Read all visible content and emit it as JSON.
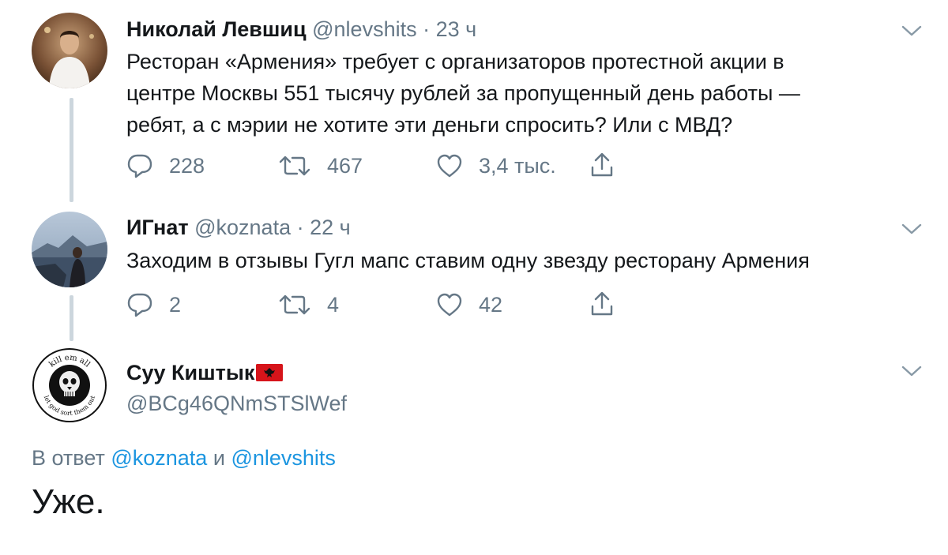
{
  "tweets": [
    {
      "name": "Николай Левшиц",
      "handle": "@nlevshits",
      "time": "23 ч",
      "text_lines": [
        "Ресторан «Армения» требует с организаторов протестной акции в",
        "центре Москвы 551 тысячу рублей за пропущенный день работы —",
        "ребят, а с мэрии не хотите эти деньги спросить? Или с МВД?"
      ],
      "replies": "228",
      "retweets": "467",
      "likes": "3,4 тыс."
    },
    {
      "name": "ИГнат",
      "handle": "@koznata",
      "time": "22 ч",
      "text_lines": [
        "Заходим в отзывы Гугл мапс ставим одну звезду ресторану Армения"
      ],
      "replies": "2",
      "retweets": "4",
      "likes": "42"
    }
  ],
  "main_tweet": {
    "name": "Суу Киштык",
    "flag_icon": "albania-flag-icon",
    "handle": "@BCg46QNmSTSlWef",
    "reply_prefix": "В ответ",
    "reply_mention_1": "@koznata",
    "reply_joiner": "и",
    "reply_mention_2": "@nlevshits",
    "text": "Уже.",
    "avatar_lettering": [
      "kill em all",
      "let god sort them out"
    ]
  },
  "separator_dot": "·",
  "colors": {
    "text": "#14171a",
    "secondary": "#657786",
    "link": "#1b95e0",
    "thread_line": "#ccd6dd"
  }
}
